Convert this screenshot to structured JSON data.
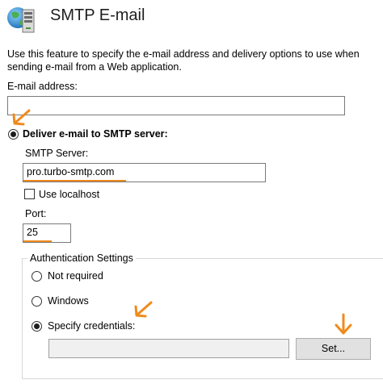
{
  "header": {
    "title": "SMTP E-mail",
    "icon": "smtp-mail-server-icon"
  },
  "description": "Use this feature to specify the e-mail address and delivery options to use when sending e-mail from a Web application.",
  "email": {
    "label": "E-mail address:",
    "value": ""
  },
  "delivery": {
    "label": "Deliver e-mail to SMTP server:",
    "selected": true
  },
  "smtp_server": {
    "label": "SMTP Server:",
    "value": "pro.turbo-smtp.com"
  },
  "use_localhost": {
    "label": "Use localhost",
    "checked": false
  },
  "port": {
    "label": "Port:",
    "value": "25"
  },
  "auth": {
    "legend": "Authentication Settings",
    "options": [
      {
        "label": "Not required",
        "checked": false
      },
      {
        "label": "Windows",
        "checked": false
      },
      {
        "label": "Specify credentials:",
        "checked": true
      }
    ],
    "credentials_value": "",
    "set_button": "Set..."
  },
  "annotations": {
    "arrow_icon": "arrow-icon",
    "accent_color": "#f08a1c"
  }
}
